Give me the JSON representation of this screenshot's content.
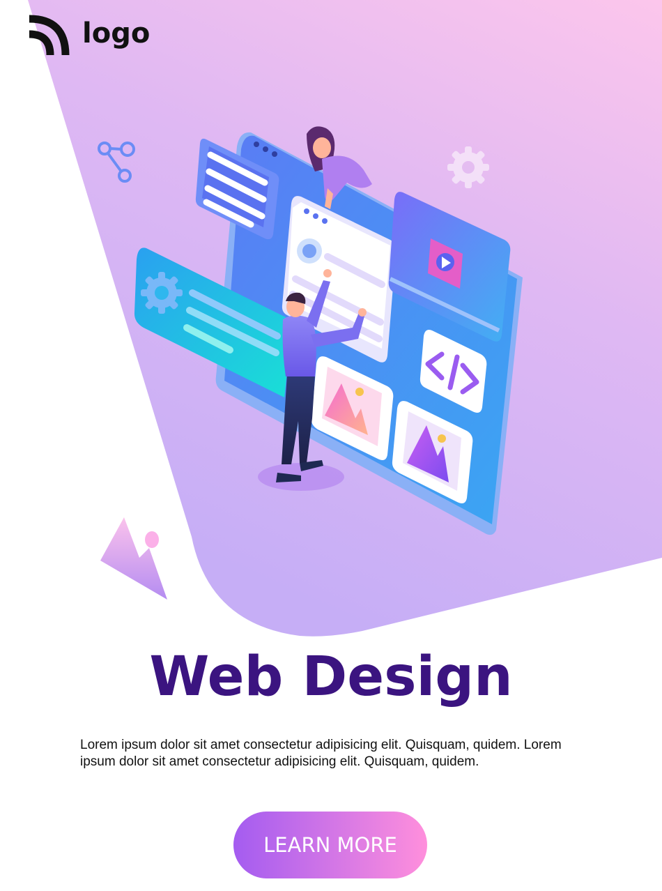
{
  "header": {
    "logo_text": "logo",
    "logo_icon": "rss-wave-icon"
  },
  "hero": {
    "title": "Web Design",
    "description": "Lorem ipsum dolor sit amet consectetur adipisicing elit. Quisquam, quidem. Lorem ipsum dolor sit amet consectetur adipisicing elit. Quisquam, quidem.",
    "cta_label": "LEARN MORE"
  },
  "colors": {
    "bg_gradient_top": "#f9c4ee",
    "bg_gradient_bottom": "#c6aef6",
    "title": "#3b1480",
    "cta_start": "#a45cf0",
    "cta_end": "#ff8fdc"
  },
  "illustration": {
    "icons": [
      "share-icon",
      "gear-icon",
      "settings-gear-icon",
      "image-icon",
      "code-icon",
      "video-play-icon",
      "mountain-image-icon"
    ]
  }
}
